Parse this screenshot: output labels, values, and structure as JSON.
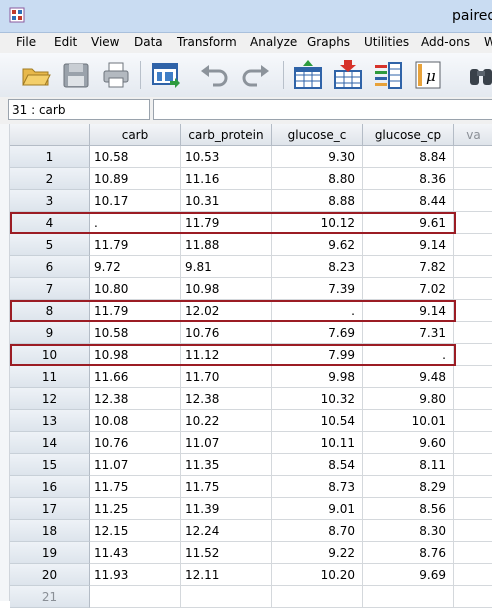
{
  "window": {
    "title": "paired"
  },
  "menu": [
    "File",
    "Edit",
    "View",
    "Data",
    "Transform",
    "Analyze",
    "Graphs",
    "Utilities",
    "Add-ons",
    "W"
  ],
  "toolbar_icons": [
    "open-folder-icon",
    "save-icon",
    "print-icon",
    "dialog-recall-icon",
    "undo-icon",
    "redo-icon",
    "goto-case-icon",
    "goto-variable-icon",
    "variables-icon",
    "value-labels-icon",
    "find-icon"
  ],
  "cell_editor": {
    "reference": "31 : carb",
    "value": ""
  },
  "columns": [
    "carb",
    "carb_protein",
    "glucose_c",
    "glucose_cp",
    "va"
  ],
  "rows": [
    {
      "n": "1",
      "carb": "10.58",
      "carb_protein": "10.53",
      "glucose_c": "9.30",
      "glucose_cp": "8.84"
    },
    {
      "n": "2",
      "carb": "10.89",
      "carb_protein": "11.16",
      "glucose_c": "8.80",
      "glucose_cp": "8.36"
    },
    {
      "n": "3",
      "carb": "10.17",
      "carb_protein": "10.31",
      "glucose_c": "8.88",
      "glucose_cp": "8.44"
    },
    {
      "n": "4",
      "carb": ".",
      "carb_protein": "11.79",
      "glucose_c": "10.12",
      "glucose_cp": "9.61"
    },
    {
      "n": "5",
      "carb": "11.79",
      "carb_protein": "11.88",
      "glucose_c": "9.62",
      "glucose_cp": "9.14"
    },
    {
      "n": "6",
      "carb": "9.72",
      "carb_protein": "9.81",
      "glucose_c": "8.23",
      "glucose_cp": "7.82"
    },
    {
      "n": "7",
      "carb": "10.80",
      "carb_protein": "10.98",
      "glucose_c": "7.39",
      "glucose_cp": "7.02"
    },
    {
      "n": "8",
      "carb": "11.79",
      "carb_protein": "12.02",
      "glucose_c": ".",
      "glucose_cp": "9.14"
    },
    {
      "n": "9",
      "carb": "10.58",
      "carb_protein": "10.76",
      "glucose_c": "7.69",
      "glucose_cp": "7.31"
    },
    {
      "n": "10",
      "carb": "10.98",
      "carb_protein": "11.12",
      "glucose_c": "7.99",
      "glucose_cp": "."
    },
    {
      "n": "11",
      "carb": "11.66",
      "carb_protein": "11.70",
      "glucose_c": "9.98",
      "glucose_cp": "9.48"
    },
    {
      "n": "12",
      "carb": "12.38",
      "carb_protein": "12.38",
      "glucose_c": "10.32",
      "glucose_cp": "9.80"
    },
    {
      "n": "13",
      "carb": "10.08",
      "carb_protein": "10.22",
      "glucose_c": "10.54",
      "glucose_cp": "10.01"
    },
    {
      "n": "14",
      "carb": "10.76",
      "carb_protein": "11.07",
      "glucose_c": "10.11",
      "glucose_cp": "9.60"
    },
    {
      "n": "15",
      "carb": "11.07",
      "carb_protein": "11.35",
      "glucose_c": "8.54",
      "glucose_cp": "8.11"
    },
    {
      "n": "16",
      "carb": "11.75",
      "carb_protein": "11.75",
      "glucose_c": "8.73",
      "glucose_cp": "8.29"
    },
    {
      "n": "17",
      "carb": "11.25",
      "carb_protein": "11.39",
      "glucose_c": "9.01",
      "glucose_cp": "8.56"
    },
    {
      "n": "18",
      "carb": "12.15",
      "carb_protein": "12.24",
      "glucose_c": "8.70",
      "glucose_cp": "8.30"
    },
    {
      "n": "19",
      "carb": "11.43",
      "carb_protein": "11.52",
      "glucose_c": "9.22",
      "glucose_cp": "8.76"
    },
    {
      "n": "20",
      "carb": "11.93",
      "carb_protein": "12.11",
      "glucose_c": "10.20",
      "glucose_cp": "9.69"
    },
    {
      "n": "21",
      "carb": "",
      "carb_protein": "",
      "glucose_c": "",
      "glucose_cp": ""
    }
  ],
  "highlighted_rows": [
    "4",
    "8",
    "10"
  ],
  "colors": {
    "highlight_border": "#9b1c24",
    "title_bar": "#c9dcf2"
  }
}
